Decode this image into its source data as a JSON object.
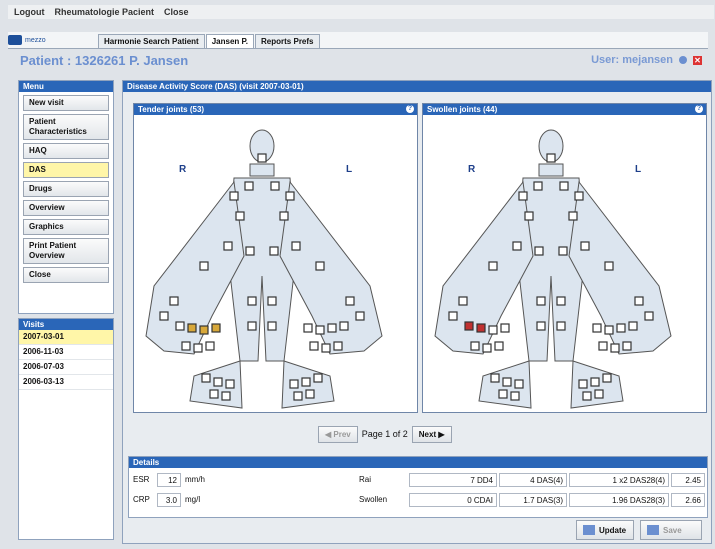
{
  "menubar": {
    "items": [
      "Logout",
      "Rheumatologie Pacient",
      "Close"
    ]
  },
  "tabs": {
    "logo": "mezzo",
    "items": [
      "Harmonie Search Patient",
      "Jansen P.",
      "Reports Prefs"
    ],
    "active_index": 1
  },
  "patient": {
    "title": "Patient : 1326261 P. Jansen",
    "user": "User: mejansen"
  },
  "menu": {
    "title": "Menu",
    "items": [
      "New visit",
      "Patient Characteristics",
      "HAQ",
      "DAS",
      "Drugs",
      "Overview",
      "Graphics",
      "Print Patient Overview",
      "Close"
    ],
    "selected_index": 3
  },
  "visits": {
    "title": "Visits",
    "items": [
      "2007-03-01",
      "2006-11-03",
      "2006-07-03",
      "2006-03-13"
    ],
    "selected_index": 0
  },
  "main": {
    "title": "Disease Activity Score (DAS) (visit 2007-03-01)"
  },
  "panels": {
    "tender": {
      "title": "Tender joints (53)",
      "r": "R",
      "l": "L"
    },
    "swollen": {
      "title": "Swollen joints (44)",
      "r": "R",
      "l": "L"
    }
  },
  "pager": {
    "prev": "Prev",
    "page": "Page 1 of 2",
    "next": "Next"
  },
  "details": {
    "title": "Details",
    "esr": {
      "label": "ESR",
      "value": "12",
      "unit": "mm/h"
    },
    "crp": {
      "label": "CRP",
      "value": "3.0",
      "unit": "mg/l"
    },
    "rai": {
      "label": "Rai",
      "c1": "7 DD4",
      "c2": "4 DAS(4)",
      "c3": "1 x2 DAS28(4)",
      "c4": "2.45"
    },
    "sw": {
      "label": "Swollen",
      "c1": "0 CDAI",
      "c2": "1.7 DAS(3)",
      "c3": "1.96 DAS28(3)",
      "c4": "2.66"
    }
  },
  "footer": {
    "update": "Update",
    "save": "Save"
  },
  "colors": {
    "accent": "#2a66b8",
    "selected": "#fff6a8",
    "tender_mark": "#d8a83a",
    "swollen_mark": "#c03030"
  }
}
